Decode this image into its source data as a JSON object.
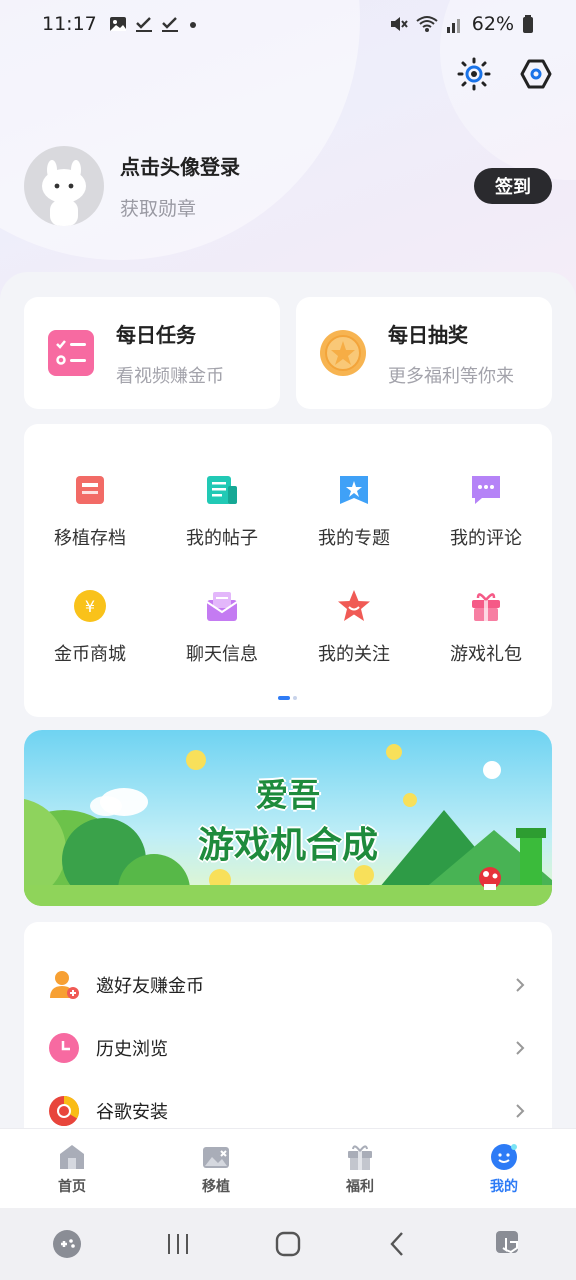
{
  "status_bar": {
    "time": "11:17",
    "battery": "62%",
    "left_icons": [
      "gallery-icon",
      "check-icon",
      "check-icon",
      "dot-icon"
    ],
    "right_icons": [
      "mute-icon",
      "wifi-icon",
      "signal-icon",
      "battery-icon"
    ]
  },
  "top_actions": [
    "sun-icon",
    "settings-hex-icon"
  ],
  "profile": {
    "login_prompt": "点击头像登录",
    "subtitle": "获取勋章",
    "signin_label": "签到"
  },
  "daily_cards": [
    {
      "title": "每日任务",
      "subtitle": "看视频赚金币",
      "icon": "task-list-icon"
    },
    {
      "title": "每日抽奖",
      "subtitle": "更多福利等你来",
      "icon": "lottery-coin-icon"
    }
  ],
  "grid": {
    "items": [
      {
        "label": "移植存档",
        "icon": "archive-icon",
        "color": "#f26b66"
      },
      {
        "label": "我的帖子",
        "icon": "post-icon",
        "color": "#21c9b5"
      },
      {
        "label": "我的专题",
        "icon": "topic-star-icon",
        "color": "#3fa1f7"
      },
      {
        "label": "我的评论",
        "icon": "comment-icon",
        "color": "#b583f7"
      },
      {
        "label": "金币商城",
        "icon": "coin-shop-icon",
        "color": "#f9c21a"
      },
      {
        "label": "聊天信息",
        "icon": "chat-mail-icon",
        "color": "#c47bf2"
      },
      {
        "label": "我的关注",
        "icon": "follow-star-icon",
        "color": "#f05a55"
      },
      {
        "label": "游戏礼包",
        "icon": "gift-icon",
        "color": "#f55a87"
      }
    ],
    "page_indicator": {
      "current": 1,
      "total": 2
    }
  },
  "banner": {
    "line1": "爱吾",
    "line2": "游戏机合成"
  },
  "list": [
    {
      "label": "邀好友赚金币",
      "icon": "invite-friend-icon"
    },
    {
      "label": "历史浏览",
      "icon": "history-clock-icon"
    },
    {
      "label": "谷歌安装",
      "icon": "google-install-icon"
    }
  ],
  "tabs": [
    {
      "label": "首页",
      "icon": "home-icon",
      "active": false
    },
    {
      "label": "移植",
      "icon": "port-icon",
      "active": false
    },
    {
      "label": "福利",
      "icon": "welfare-gift-icon",
      "active": false
    },
    {
      "label": "我的",
      "icon": "profile-face-icon",
      "active": true
    }
  ],
  "colors": {
    "accent": "#2d7bf6",
    "signin_bg": "#2a2a2e",
    "banner_green": "#1e8b3c"
  }
}
